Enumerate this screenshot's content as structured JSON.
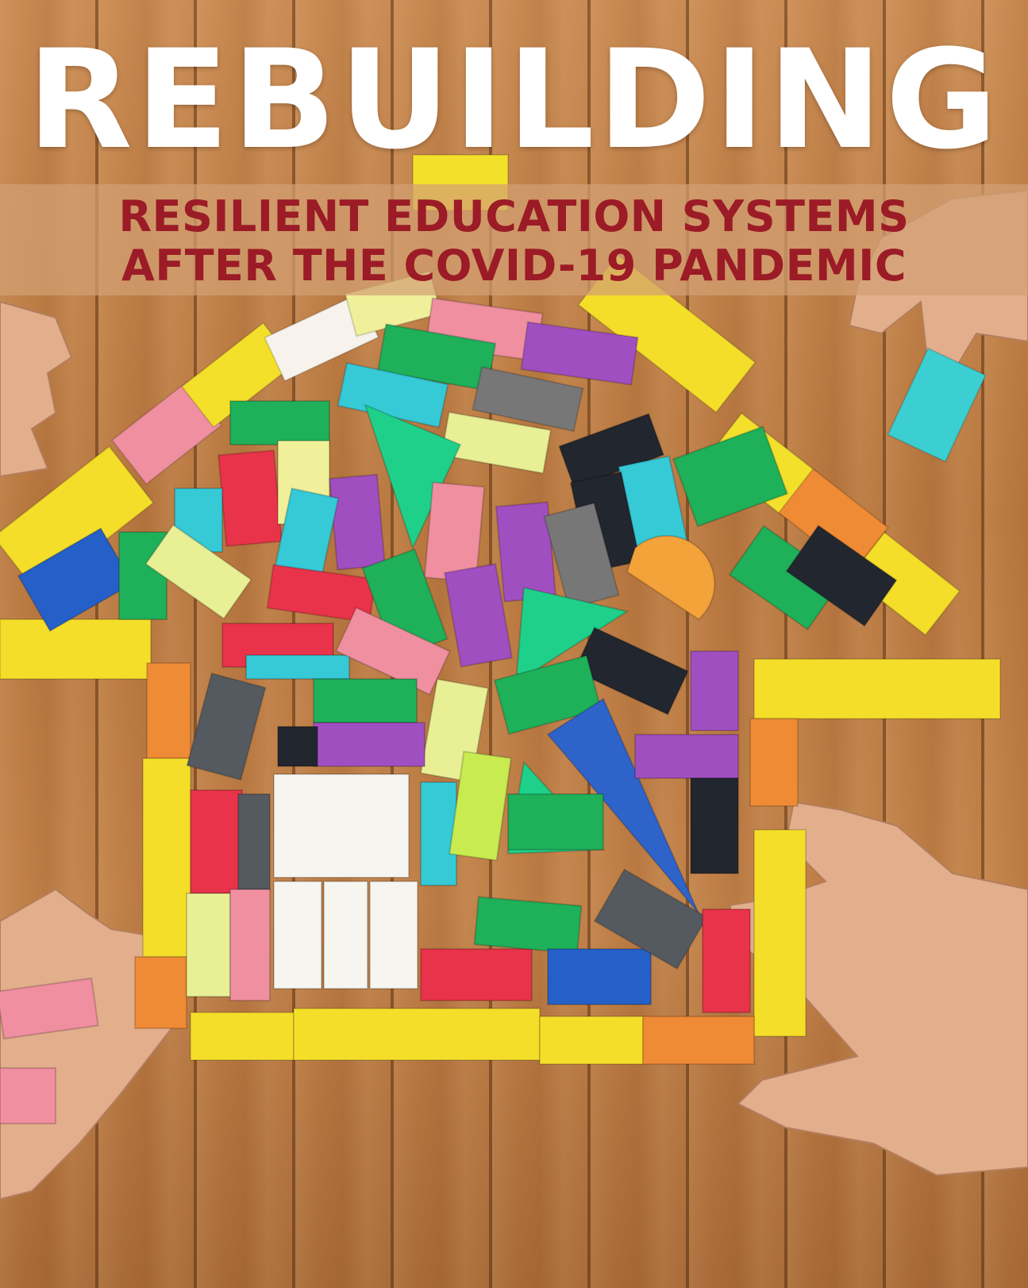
{
  "cover": {
    "title": "REBUILDING",
    "subtitle_line1": "RESILIENT EDUCATION SYSTEMS",
    "subtitle_line2": "AFTER THE COVID-19 PANDEMIC"
  },
  "colors": {
    "title": "#ffffff",
    "subtitle": "#9b1b26",
    "wood": "#b87840",
    "band": "#d2a073"
  }
}
